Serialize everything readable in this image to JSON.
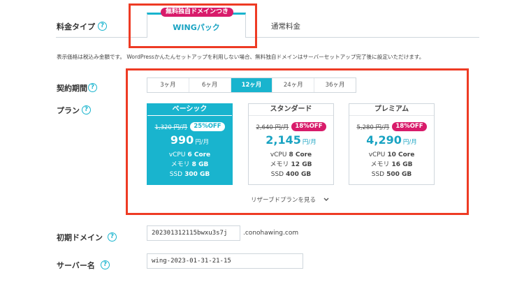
{
  "plan_type": {
    "label": "料金タイプ",
    "help": "?",
    "tabs": [
      {
        "label": "WINGパック",
        "badge": "無料独自ドメインつき",
        "active": true
      },
      {
        "label": "通常料金",
        "active": false
      }
    ]
  },
  "note": "表示価格は税込み金額です。 WordPressかんたんセットアップを利用しない場合、無料独自ドメインはサーバーセットアップ完了後に設定いただけます。",
  "contract_period": {
    "label": "契約期間",
    "help": "?",
    "options": [
      "3ヶ月",
      "6ヶ月",
      "12ヶ月",
      "24ヶ月",
      "36ヶ月"
    ],
    "selected": "12ヶ月"
  },
  "plan": {
    "label": "プラン",
    "help": "?",
    "cards": [
      {
        "name": "ベーシック",
        "original_price": "1,320 円/月",
        "discount": "25%OFF",
        "price": "990",
        "unit": "円/月",
        "specs": [
          {
            "k": "vCPU",
            "v": "6 Core"
          },
          {
            "k": "メモリ",
            "v": "8 GB"
          },
          {
            "k": "SSD",
            "v": "300 GB"
          }
        ],
        "selected": true
      },
      {
        "name": "スタンダード",
        "original_price": "2,640 円/月",
        "discount": "18%OFF",
        "price": "2,145",
        "unit": "円/月",
        "specs": [
          {
            "k": "vCPU",
            "v": "8 Core"
          },
          {
            "k": "メモリ",
            "v": "12 GB"
          },
          {
            "k": "SSD",
            "v": "400 GB"
          }
        ],
        "selected": false
      },
      {
        "name": "プレミアム",
        "original_price": "5,280 円/月",
        "discount": "18%OFF",
        "price": "4,290",
        "unit": "円/月",
        "specs": [
          {
            "k": "vCPU",
            "v": "10 Core"
          },
          {
            "k": "メモリ",
            "v": "16 GB"
          },
          {
            "k": "SSD",
            "v": "500 GB"
          }
        ],
        "selected": false
      }
    ],
    "more_link": "リザーブドプランを見る"
  },
  "initial_domain": {
    "label": "初期ドメイン",
    "help": "?",
    "value": "202301312115bwxu3s7j",
    "suffix": ".conohawing.com"
  },
  "server_name": {
    "label": "サーバー名",
    "help": "?",
    "value": "wing-2023-01-31-21-15"
  },
  "colors": {
    "accent": "#19b4ce",
    "pink": "#d81b6a",
    "highlight_red": "#ee3b24"
  }
}
